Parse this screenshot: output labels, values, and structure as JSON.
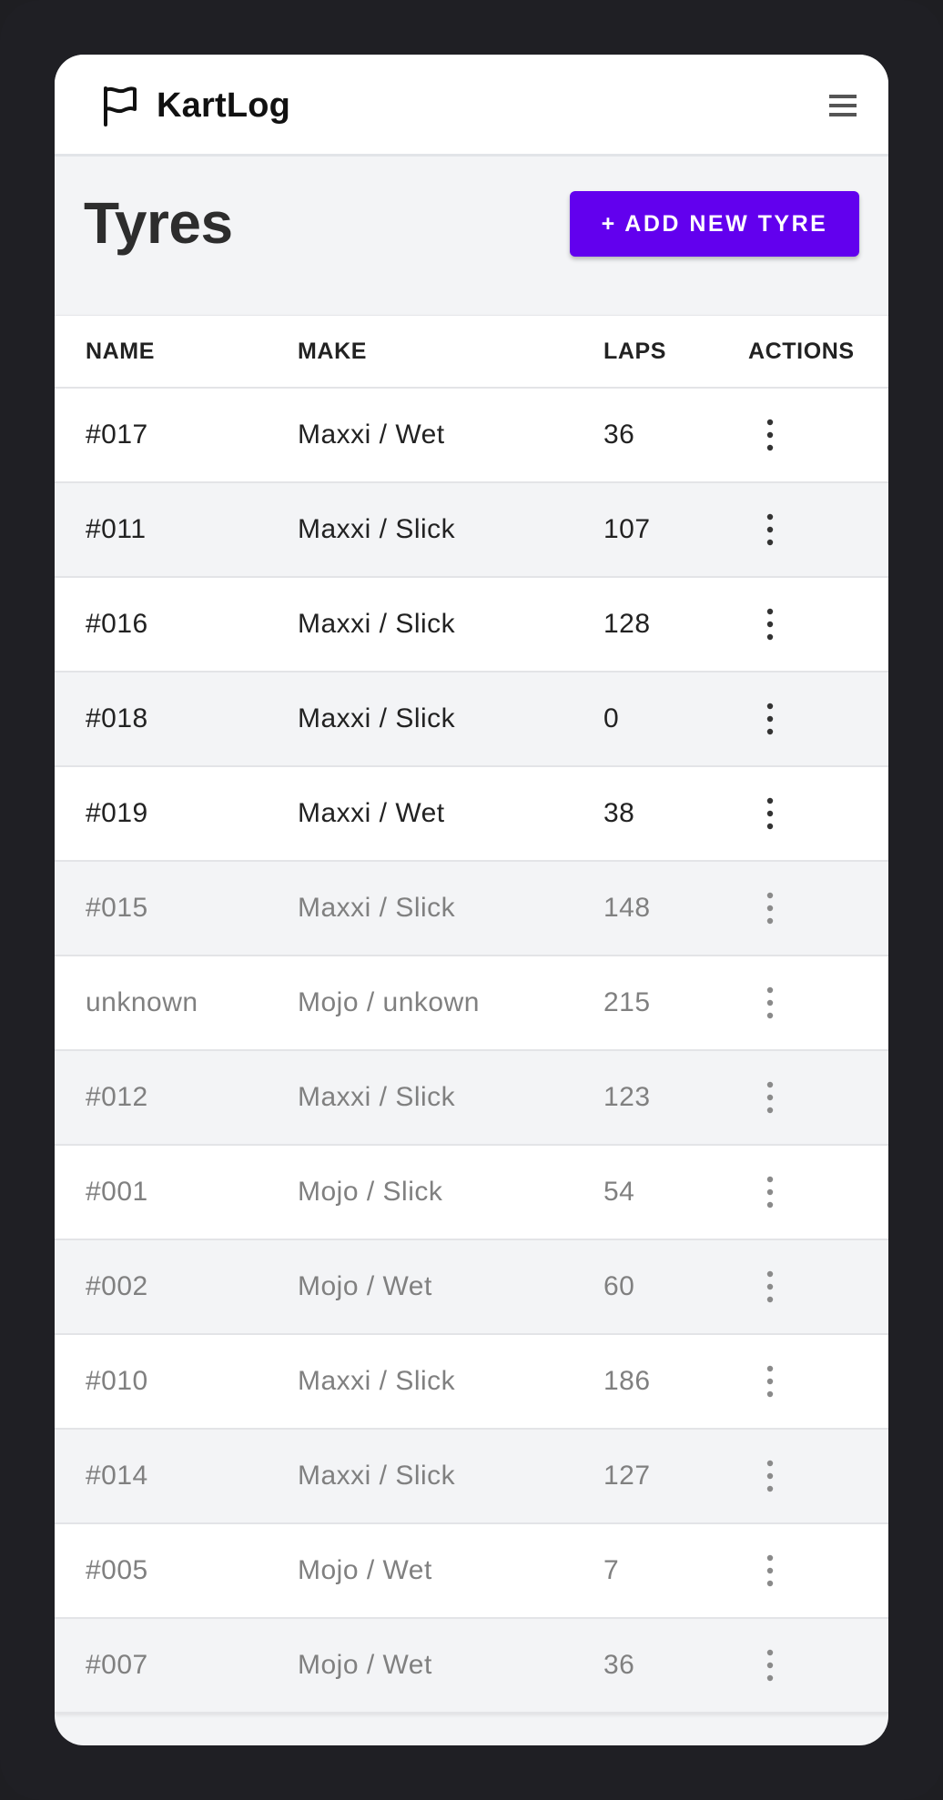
{
  "app": {
    "name": "KartLog"
  },
  "page": {
    "title": "Tyres",
    "add_button_label": "+ ADD NEW TYRE"
  },
  "table": {
    "columns": [
      "NAME",
      "MAKE",
      "LAPS",
      "ACTIONS"
    ],
    "rows": [
      {
        "name": "#017",
        "make": "Maxxi / Wet",
        "laps": "36",
        "active": true
      },
      {
        "name": "#011",
        "make": "Maxxi / Slick",
        "laps": "107",
        "active": true
      },
      {
        "name": "#016",
        "make": "Maxxi / Slick",
        "laps": "128",
        "active": true
      },
      {
        "name": "#018",
        "make": "Maxxi / Slick",
        "laps": "0",
        "active": true
      },
      {
        "name": "#019",
        "make": "Maxxi / Wet",
        "laps": "38",
        "active": true
      },
      {
        "name": "#015",
        "make": "Maxxi / Slick",
        "laps": "148",
        "active": false
      },
      {
        "name": "unknown",
        "make": "Mojo / unkown",
        "laps": "215",
        "active": false
      },
      {
        "name": "#012",
        "make": "Maxxi / Slick",
        "laps": "123",
        "active": false
      },
      {
        "name": "#001",
        "make": "Mojo / Slick",
        "laps": "54",
        "active": false
      },
      {
        "name": "#002",
        "make": "Mojo / Wet",
        "laps": "60",
        "active": false
      },
      {
        "name": "#010",
        "make": "Maxxi / Slick",
        "laps": "186",
        "active": false
      },
      {
        "name": "#014",
        "make": "Maxxi / Slick",
        "laps": "127",
        "active": false
      },
      {
        "name": "#005",
        "make": "Mojo / Wet",
        "laps": "7",
        "active": false
      },
      {
        "name": "#007",
        "make": "Mojo / Wet",
        "laps": "36",
        "active": false
      }
    ]
  },
  "icons": {
    "brand": "flag-icon",
    "menu": "hamburger-menu-icon",
    "row_actions": "more-vert-icon"
  },
  "colors": {
    "accent": "#6200ee",
    "inactive_text": "#808080"
  }
}
